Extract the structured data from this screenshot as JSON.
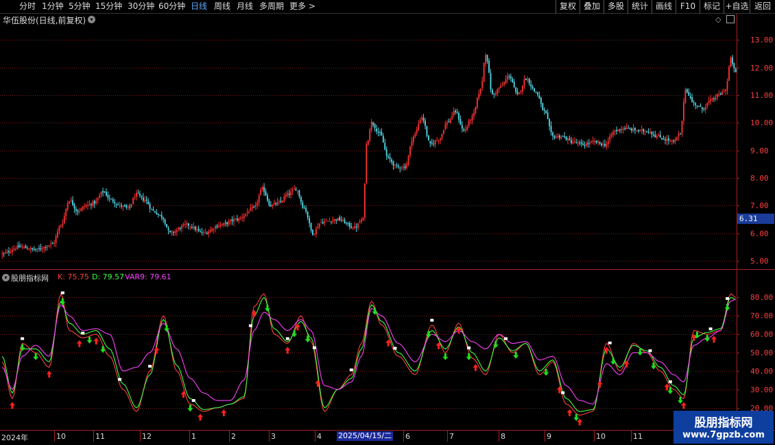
{
  "toolbar": {
    "periods": [
      "分时",
      "1分钟",
      "5分钟",
      "15分钟",
      "30分钟",
      "60分钟",
      "日线",
      "周线",
      "月线",
      "多周期",
      "更多 >"
    ],
    "active_period": "日线",
    "buttons": [
      "复权",
      "叠加",
      "多股",
      "统计",
      "画线",
      "F10",
      "标记",
      "+自选",
      "返回"
    ]
  },
  "main_panel": {
    "title": "华伍股份(日线,前复权)",
    "current_price": "6.31"
  },
  "indicator_panel": {
    "name": "股朋指标网",
    "values": [
      {
        "text": "K: 75.75",
        "color": "#ff4040"
      },
      {
        "text": "D: 79.57",
        "color": "#40ff40"
      },
      {
        "text": "VAR9: 79.61",
        "color": "#ff40ff"
      }
    ]
  },
  "x_axis": {
    "labels": [
      {
        "text": "2024年",
        "x": 2
      },
      {
        "text": "10",
        "x": 82
      },
      {
        "text": "11",
        "x": 139
      },
      {
        "text": "12",
        "x": 207
      },
      {
        "text": "1",
        "x": 279
      },
      {
        "text": "2",
        "x": 337
      },
      {
        "text": "3",
        "x": 395
      },
      {
        "text": "4",
        "x": 462
      },
      {
        "text": "6",
        "x": 591
      },
      {
        "text": "7",
        "x": 655
      },
      {
        "text": "8",
        "x": 730
      },
      {
        "text": "9",
        "x": 797
      },
      {
        "text": "10",
        "x": 869
      },
      {
        "text": "11",
        "x": 923
      }
    ],
    "selected": "2025/04/15/二"
  },
  "watermark": {
    "line1": "股朋指标网",
    "line2": "www.7gpzb.com"
  },
  "chart_data": [
    {
      "type": "candlestick",
      "title": "华伍股份(日线,前复权)",
      "y_ticks": [
        "5.00",
        "6.00",
        "7.00",
        "8.00",
        "9.00",
        "10.00",
        "11.00",
        "12.00",
        "13.00"
      ],
      "ylim": [
        4.7,
        13.5
      ],
      "close_keypoints": [
        [
          0,
          5.25
        ],
        [
          10,
          5.5
        ],
        [
          20,
          5.4
        ],
        [
          30,
          5.6
        ],
        [
          35,
          6.3
        ],
        [
          40,
          7.2
        ],
        [
          45,
          6.8
        ],
        [
          50,
          7.0
        ],
        [
          55,
          7.1
        ],
        [
          60,
          7.5
        ],
        [
          65,
          7.2
        ],
        [
          70,
          7.0
        ],
        [
          75,
          6.9
        ],
        [
          80,
          7.4
        ],
        [
          85,
          7.2
        ],
        [
          90,
          6.8
        ],
        [
          95,
          6.6
        ],
        [
          100,
          6.0
        ],
        [
          110,
          6.3
        ],
        [
          120,
          6.0
        ],
        [
          130,
          6.3
        ],
        [
          140,
          6.5
        ],
        [
          150,
          6.9
        ],
        [
          155,
          7.6
        ],
        [
          160,
          7.0
        ],
        [
          165,
          7.1
        ],
        [
          170,
          7.4
        ],
        [
          175,
          7.6
        ],
        [
          180,
          6.9
        ],
        [
          185,
          6.0
        ],
        [
          190,
          6.4
        ],
        [
          200,
          6.5
        ],
        [
          210,
          6.2
        ],
        [
          215,
          6.5
        ],
        [
          217,
          9.2
        ],
        [
          220,
          10.0
        ],
        [
          225,
          9.6
        ],
        [
          230,
          8.7
        ],
        [
          235,
          8.4
        ],
        [
          240,
          8.4
        ],
        [
          245,
          9.5
        ],
        [
          250,
          10.2
        ],
        [
          255,
          9.2
        ],
        [
          260,
          9.4
        ],
        [
          265,
          10.0
        ],
        [
          270,
          10.4
        ],
        [
          275,
          9.7
        ],
        [
          280,
          10.2
        ],
        [
          285,
          11.2
        ],
        [
          288,
          12.5
        ],
        [
          292,
          11.0
        ],
        [
          297,
          11.3
        ],
        [
          302,
          11.7
        ],
        [
          307,
          11.0
        ],
        [
          312,
          11.6
        ],
        [
          318,
          11.1
        ],
        [
          323,
          10.4
        ],
        [
          328,
          9.5
        ],
        [
          333,
          9.5
        ],
        [
          340,
          9.3
        ],
        [
          346,
          9.2
        ],
        [
          353,
          9.3
        ],
        [
          359,
          9.2
        ],
        [
          365,
          9.7
        ],
        [
          370,
          9.8
        ],
        [
          375,
          9.75
        ],
        [
          380,
          9.7
        ],
        [
          385,
          9.7
        ],
        [
          390,
          9.5
        ],
        [
          395,
          9.4
        ],
        [
          400,
          9.3
        ],
        [
          404,
          9.6
        ],
        [
          407,
          11.2
        ],
        [
          412,
          10.7
        ],
        [
          417,
          10.5
        ],
        [
          422,
          10.8
        ],
        [
          427,
          11.0
        ],
        [
          431,
          11.2
        ],
        [
          434,
          12.3
        ],
        [
          437,
          11.8
        ]
      ],
      "n_candles": 438
    },
    {
      "type": "line",
      "title": "股朋指标网",
      "y_ticks": [
        "20.00",
        "30.00",
        "40.00",
        "50.00",
        "60.00",
        "70.00",
        "80.00"
      ],
      "ylim": [
        18,
        88
      ],
      "series": [
        {
          "name": "K",
          "color": "#ff4040",
          "values": [
            [
              0,
              45
            ],
            [
              6,
              25
            ],
            [
              12,
              55
            ],
            [
              20,
              50
            ],
            [
              28,
              42
            ],
            [
              35,
              82
            ],
            [
              40,
              62
            ],
            [
              48,
              58
            ],
            [
              56,
              60
            ],
            [
              64,
              48
            ],
            [
              72,
              30
            ],
            [
              80,
              18
            ],
            [
              88,
              40
            ],
            [
              96,
              70
            ],
            [
              104,
              40
            ],
            [
              112,
              22
            ],
            [
              120,
              18
            ],
            [
              128,
              20
            ],
            [
              136,
              22
            ],
            [
              144,
              25
            ],
            [
              150,
              75
            ],
            [
              156,
              82
            ],
            [
              162,
              60
            ],
            [
              170,
              55
            ],
            [
              178,
              70
            ],
            [
              184,
              56
            ],
            [
              192,
              18
            ],
            [
              200,
              30
            ],
            [
              208,
              38
            ],
            [
              214,
              55
            ],
            [
              220,
              78
            ],
            [
              226,
              65
            ],
            [
              236,
              48
            ],
            [
              246,
              38
            ],
            [
              256,
              65
            ],
            [
              264,
              50
            ],
            [
              272,
              66
            ],
            [
              280,
              47
            ],
            [
              288,
              38
            ],
            [
              296,
              60
            ],
            [
              304,
              50
            ],
            [
              312,
              55
            ],
            [
              320,
              38
            ],
            [
              328,
              45
            ],
            [
              336,
              22
            ],
            [
              344,
              16
            ],
            [
              352,
              18
            ],
            [
              360,
              55
            ],
            [
              368,
              40
            ],
            [
              376,
              55
            ],
            [
              384,
              50
            ],
            [
              392,
              40
            ],
            [
              400,
              30
            ],
            [
              406,
              25
            ],
            [
              412,
              62
            ],
            [
              420,
              60
            ],
            [
              428,
              62
            ],
            [
              434,
              82
            ],
            [
              437,
              80
            ]
          ]
        },
        {
          "name": "D",
          "color": "#40ff40",
          "values": [
            [
              0,
              48
            ],
            [
              6,
              28
            ],
            [
              12,
              52
            ],
            [
              20,
              52
            ],
            [
              28,
              45
            ],
            [
              35,
              78
            ],
            [
              40,
              66
            ],
            [
              48,
              60
            ],
            [
              56,
              62
            ],
            [
              64,
              52
            ],
            [
              72,
              33
            ],
            [
              80,
              20
            ],
            [
              88,
              38
            ],
            [
              96,
              68
            ],
            [
              104,
              43
            ],
            [
              112,
              25
            ],
            [
              120,
              19
            ],
            [
              128,
              20
            ],
            [
              136,
              22
            ],
            [
              144,
              26
            ],
            [
              150,
              70
            ],
            [
              156,
              80
            ],
            [
              162,
              63
            ],
            [
              170,
              56
            ],
            [
              178,
              67
            ],
            [
              184,
              58
            ],
            [
              192,
              20
            ],
            [
              200,
              30
            ],
            [
              208,
              36
            ],
            [
              214,
              52
            ],
            [
              220,
              76
            ],
            [
              226,
              67
            ],
            [
              236,
              50
            ],
            [
              246,
              40
            ],
            [
              256,
              62
            ],
            [
              264,
              52
            ],
            [
              272,
              64
            ],
            [
              280,
              50
            ],
            [
              288,
              40
            ],
            [
              296,
              58
            ],
            [
              304,
              51
            ],
            [
              312,
              55
            ],
            [
              320,
              40
            ],
            [
              328,
              46
            ],
            [
              336,
              25
            ],
            [
              344,
              18
            ],
            [
              352,
              19
            ],
            [
              360,
              52
            ],
            [
              368,
              42
            ],
            [
              376,
              54
            ],
            [
              384,
              51
            ],
            [
              392,
              42
            ],
            [
              400,
              32
            ],
            [
              406,
              27
            ],
            [
              412,
              58
            ],
            [
              420,
              61
            ],
            [
              428,
              63
            ],
            [
              434,
              80
            ],
            [
              437,
              79
            ]
          ]
        },
        {
          "name": "VAR9",
          "color": "#ff40ff",
          "values": [
            [
              0,
              42
            ],
            [
              6,
              30
            ],
            [
              12,
              48
            ],
            [
              20,
              54
            ],
            [
              28,
              48
            ],
            [
              35,
              76
            ],
            [
              40,
              70
            ],
            [
              48,
              62
            ],
            [
              56,
              63
            ],
            [
              64,
              60
            ],
            [
              72,
              40
            ],
            [
              80,
              42
            ],
            [
              88,
              50
            ],
            [
              96,
              66
            ],
            [
              104,
              52
            ],
            [
              112,
              36
            ],
            [
              120,
              28
            ],
            [
              128,
              24
            ],
            [
              136,
              24
            ],
            [
              144,
              35
            ],
            [
              150,
              62
            ],
            [
              156,
              72
            ],
            [
              162,
              68
            ],
            [
              170,
              62
            ],
            [
              178,
              68
            ],
            [
              184,
              62
            ],
            [
              192,
              32
            ],
            [
              200,
              30
            ],
            [
              208,
              34
            ],
            [
              214,
              48
            ],
            [
              220,
              74
            ],
            [
              226,
              70
            ],
            [
              236,
              55
            ],
            [
              246,
              45
            ],
            [
              256,
              60
            ],
            [
              264,
              56
            ],
            [
              272,
              62
            ],
            [
              280,
              56
            ],
            [
              288,
              52
            ],
            [
              296,
              60
            ],
            [
              304,
              55
            ],
            [
              312,
              56
            ],
            [
              320,
              46
            ],
            [
              328,
              48
            ],
            [
              336,
              32
            ],
            [
              344,
              24
            ],
            [
              352,
              22
            ],
            [
              360,
              44
            ],
            [
              368,
              38
            ],
            [
              376,
              50
            ],
            [
              384,
              50
            ],
            [
              392,
              45
            ],
            [
              400,
              38
            ],
            [
              406,
              34
            ],
            [
              412,
              54
            ],
            [
              420,
              58
            ],
            [
              428,
              62
            ],
            [
              434,
              78
            ],
            [
              437,
              79
            ]
          ]
        }
      ],
      "buy_markers": [
        6,
        28,
        46,
        56,
        92,
        108,
        118,
        132,
        150,
        170,
        176,
        188,
        230,
        260,
        272,
        282,
        332,
        338,
        344,
        356,
        360,
        372,
        396,
        406,
        412,
        424
      ],
      "sell_markers": [
        12,
        20,
        36,
        52,
        60,
        98,
        112,
        158,
        174,
        182,
        222,
        254,
        264,
        278,
        294,
        306,
        324,
        342,
        364,
        380,
        388,
        398,
        404,
        414,
        420,
        432
      ]
    }
  ]
}
